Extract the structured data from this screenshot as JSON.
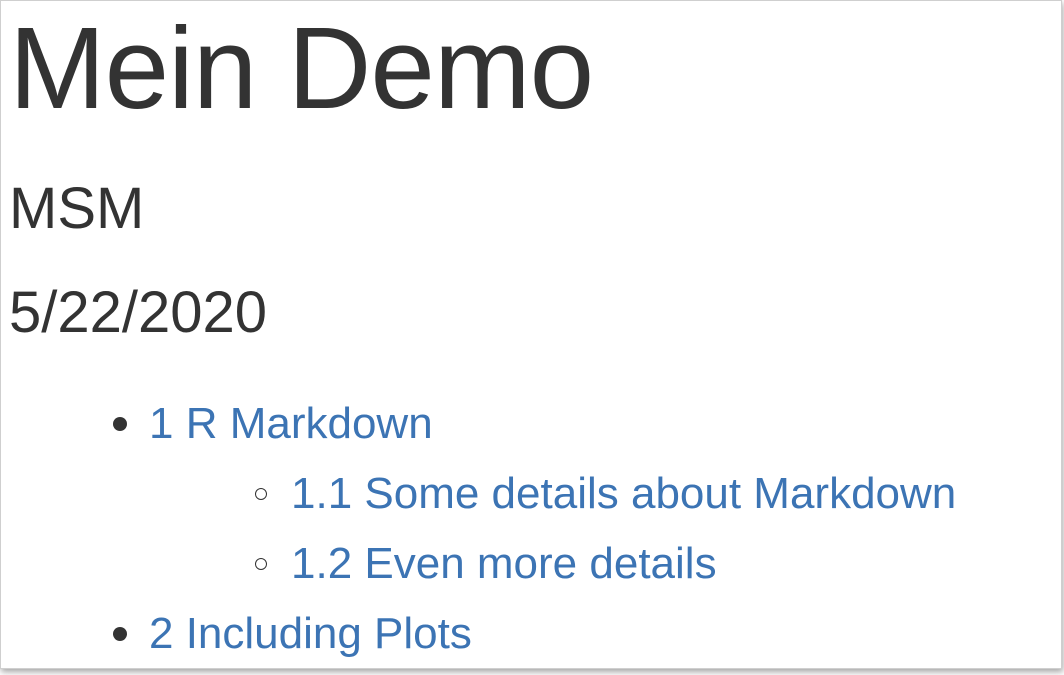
{
  "document": {
    "title": "Mein Demo",
    "author": "MSM",
    "date": "5/22/2020"
  },
  "toc": {
    "items": [
      {
        "label": "1 R Markdown",
        "children": [
          {
            "label": "1.1 Some details about Markdown"
          },
          {
            "label": "1.2 Even more details"
          }
        ]
      },
      {
        "label": "2 Including Plots"
      }
    ]
  },
  "colors": {
    "text": "#333333",
    "link": "#3c74b4",
    "background": "#ffffff"
  }
}
